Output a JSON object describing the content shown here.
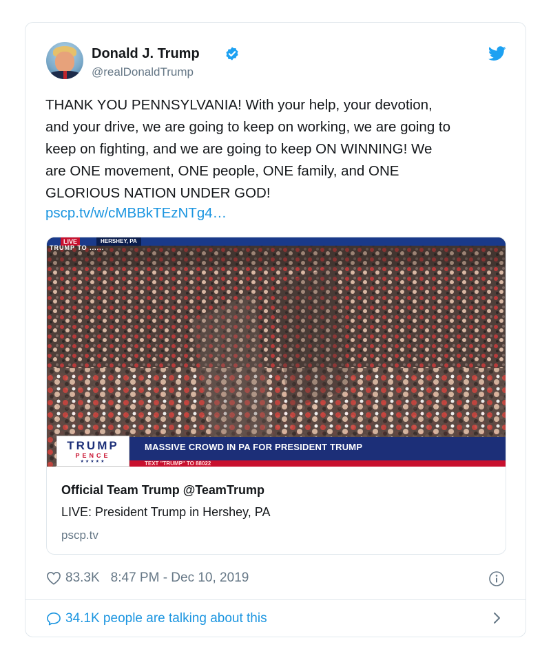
{
  "author": {
    "name": "Donald J. Trump",
    "handle": "@realDonaldTrump"
  },
  "tweet": {
    "text": "THANK YOU PENNSYLVANIA! With your help, your devotion,\nand your drive, we are going to keep on working, we are going to\nkeep on fighting, and we are going to keep ON WINNING! We\nare ONE movement, ONE people, ONE family, and ONE\nGLORIOUS NATION UNDER GOD!",
    "link": "pscp.tv/w/cMBBkTEzNTg4…"
  },
  "media": {
    "live_tag": "LIVE",
    "location_tag": "HERSHEY, PA",
    "top_brand": "TRUMP TO ......",
    "logo_main": "TRUMP",
    "logo_sub": "PENCE",
    "logo_stars": "★★★★★",
    "banner": "MASSIVE CROWD IN PA FOR PRESIDENT TRUMP",
    "ticker": "TEXT \"TRUMP\" TO 88022"
  },
  "link_card": {
    "title": "Official Team Trump @TeamTrump",
    "description": "LIVE: President Trump in Hershey, PA",
    "domain": "pscp.tv"
  },
  "meta": {
    "likes": "83.3K",
    "timestamp": "8:47 PM - Dec 10, 2019"
  },
  "footer": {
    "talking": "34.1K people are talking about this"
  },
  "colors": {
    "link_blue": "#1b95e0",
    "muted_gray": "#657786",
    "border": "#e1e8ed"
  },
  "icons": [
    "verified-badge-icon",
    "twitter-bird-icon",
    "heart-icon",
    "info-icon",
    "comment-bubble-icon",
    "chevron-right-icon"
  ]
}
